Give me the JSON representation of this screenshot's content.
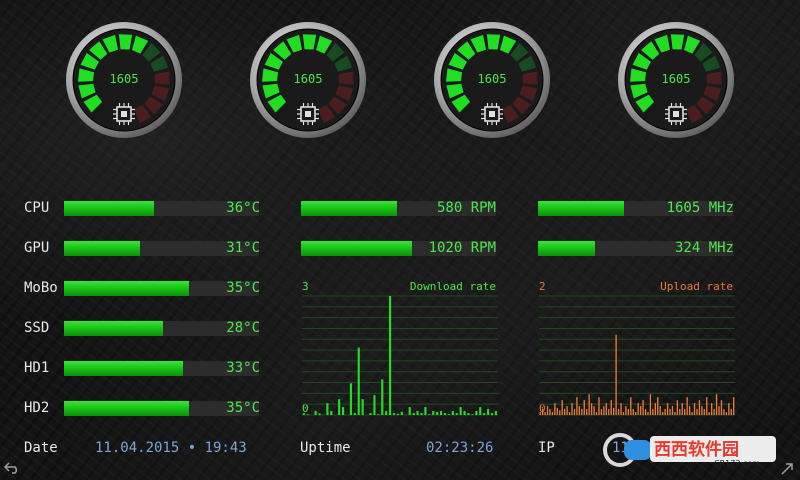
{
  "colors": {
    "accent_green": "#22dd22",
    "value_green": "#4be84b",
    "upload_orange": "#e87a3a",
    "date_blue": "#7aa6d8"
  },
  "gauges": [
    {
      "value": "1605",
      "level": 0.55
    },
    {
      "value": "1605",
      "level": 0.55
    },
    {
      "value": "1605",
      "level": 0.55
    },
    {
      "value": "1605",
      "level": 0.55
    }
  ],
  "temperatures": [
    {
      "label": "CPU",
      "value": "36°C",
      "level": 0.46
    },
    {
      "label": "GPU",
      "value": "31°C",
      "level": 0.39
    },
    {
      "label": "MoBo",
      "value": "35°C",
      "level": 0.64
    },
    {
      "label": "SSD",
      "value": "28°C",
      "level": 0.51
    },
    {
      "label": "HD1",
      "value": "33°C",
      "level": 0.61
    },
    {
      "label": "HD2",
      "value": "35°C",
      "level": 0.64
    }
  ],
  "fans": [
    {
      "value": "580 RPM",
      "level": 0.49
    },
    {
      "value": "1020 RPM",
      "level": 0.57
    }
  ],
  "clocks": [
    {
      "value": "1605 MHz",
      "level": 0.44
    },
    {
      "value": "324 MHz",
      "level": 0.29
    }
  ],
  "download": {
    "title": "Download rate",
    "ymax_label": "3",
    "ymin_label": "0",
    "color": "#22dd22",
    "values": [
      0.05,
      0.02,
      0,
      0.1,
      0.04,
      0,
      0.3,
      0.1,
      0,
      0.4,
      0.2,
      0,
      0.8,
      0.05,
      1.7,
      0.4,
      0,
      0.05,
      0.5,
      0.02,
      0.9,
      0.1,
      3.0,
      0.05,
      0.03,
      0.08,
      0,
      0.2,
      0.05,
      0.1,
      0.05,
      0.2,
      0.02,
      0.1,
      0.08,
      0.1,
      0.05,
      0.02,
      0.1,
      0.05,
      0.2,
      0.1,
      0.05,
      0.02,
      0.1,
      0.2,
      0.05,
      0.15,
      0.05,
      0.1
    ]
  },
  "upload": {
    "title": "Upload rate",
    "ymax_label": "2",
    "ymin_label": "0",
    "color": "#e87a3a",
    "values": [
      0.05,
      0.1,
      0.05,
      0.15,
      0.1,
      0.05,
      0.2,
      0.12,
      0.08,
      0.25,
      0.1,
      0.15,
      0.05,
      0.2,
      0.1,
      0.3,
      0.15,
      0.1,
      0.25,
      0.1,
      0.35,
      0.2,
      0.15,
      0.05,
      0.3,
      0.1,
      0.15,
      0.2,
      0.1,
      0.25,
      0.12,
      1.35,
      0.1,
      0.2,
      0.05,
      0.15,
      0.1,
      0.3,
      0.1,
      0.05,
      0.2,
      0.15,
      0.25,
      0.1,
      0.05,
      0.35,
      0.1,
      0.2,
      0.3,
      0.15,
      0.05,
      0.1,
      0.2,
      0.1,
      0.15,
      0.05,
      0.25,
      0.1,
      0.2,
      0.1,
      0.3,
      0.15,
      0.05,
      0.2,
      0.1,
      0.25,
      0.15,
      0.1,
      0.3,
      0.05,
      0.2,
      0.1,
      0.35,
      0.15,
      0.25,
      0.1,
      0.05,
      0.2,
      0.1,
      0.3
    ]
  },
  "bottom": {
    "date_label": "Date",
    "date_value": "11.04.2015 • 19:43",
    "uptime_label": "Uptime",
    "uptime_value": "02:23:26",
    "ip_label": "IP",
    "ip_value": "11"
  },
  "watermark": {
    "text": "西西软件园",
    "sub": "CR173.com"
  },
  "icons": {
    "back": "back-arrow-icon",
    "menu": "menu-icon"
  }
}
